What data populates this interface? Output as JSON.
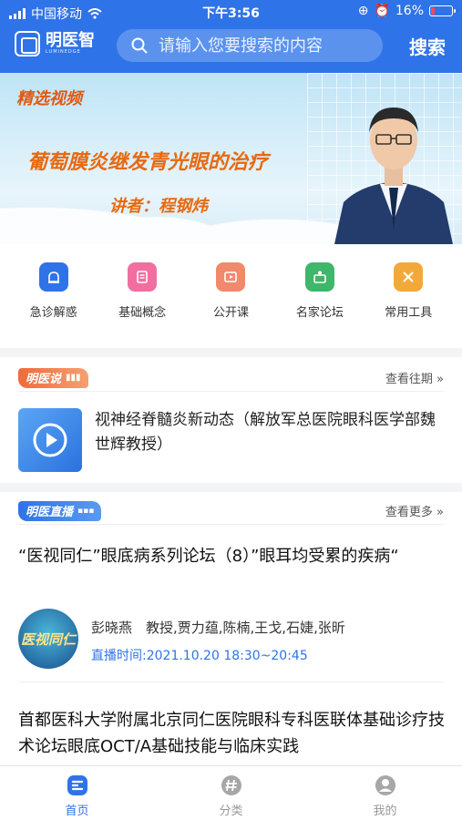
{
  "status_bar": {
    "carrier": "中国移动",
    "time": "下午3:56",
    "battery": "16%"
  },
  "header": {
    "logo_text": "明医智",
    "logo_subtext": "LUMINEDGE",
    "search_placeholder": "请输入您要搜索的内容",
    "search_button": "搜索"
  },
  "banner": {
    "tag": "精选视频",
    "title": "葡萄膜炎继发青光眼的治疗",
    "speaker": "讲者：程钢炜"
  },
  "quick_nav": [
    {
      "label": "急诊解惑",
      "icon": "emergency-icon",
      "color": "#2f73e8"
    },
    {
      "label": "基础概念",
      "icon": "book-icon",
      "color": "#f06fa0"
    },
    {
      "label": "公开课",
      "icon": "play-icon",
      "color": "#f08a6a"
    },
    {
      "label": "名家论坛",
      "icon": "forum-icon",
      "color": "#3fb66a"
    },
    {
      "label": "常用工具",
      "icon": "tools-icon",
      "color": "#f3a93a"
    }
  ],
  "section_mingyishuo": {
    "badge": "明医说",
    "more": "查看往期 »",
    "video_title": "视神经脊髓炎新动态（解放军总医院眼科医学部魏世辉教授）"
  },
  "section_live": {
    "badge": "明医直播",
    "more": "查看更多 »",
    "title": "“医视同仁”眼底病系列论坛（8）”眼耳均受累的疾病“",
    "thumb_text": "医视同仁",
    "hosts": "彭晓燕　教授,贾力蕴,陈楠,王戈,石婕,张昕",
    "time": "直播时间:2021.10.20 18:30~20:45"
  },
  "article": {
    "title": "首都医科大学附属北京同仁医院眼科专科医联体基础诊疗技术论坛眼底OCT/A基础技能与临床实践"
  },
  "tabbar": [
    {
      "label": "首页",
      "icon": "home-icon",
      "active": true
    },
    {
      "label": "分类",
      "icon": "category-icon",
      "active": false
    },
    {
      "label": "我的",
      "icon": "profile-icon",
      "active": false
    }
  ],
  "colors": {
    "primary": "#2f73e8",
    "banner_text": "#e8690f",
    "badge_orange": "#f07a4a"
  }
}
